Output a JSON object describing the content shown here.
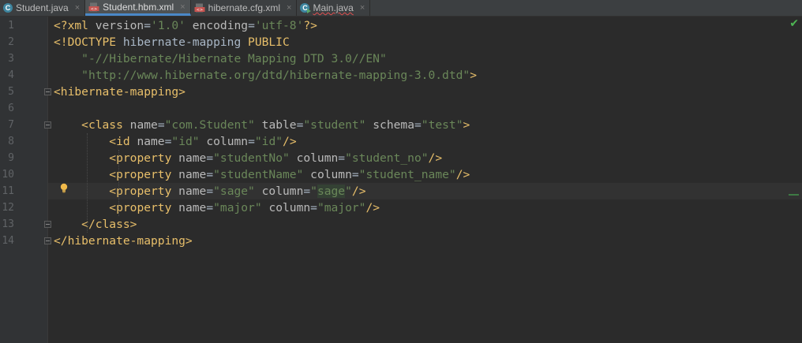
{
  "tabs": [
    {
      "label": "Student.java",
      "icon": "java-class-icon",
      "active": false
    },
    {
      "label": "Student.hbm.xml",
      "icon": "xml-file-icon",
      "active": true
    },
    {
      "label": "hibernate.cfg.xml",
      "icon": "xml-file-icon",
      "active": false
    },
    {
      "label": "Main.java",
      "icon": "java-main-class-icon",
      "active": false
    }
  ],
  "close_glyph": "×",
  "editor": {
    "current_line": 11,
    "lines": [
      {
        "n": "1",
        "tokens": [
          [
            "t-tag",
            "<?xml "
          ],
          [
            "t-attr",
            "version"
          ],
          [
            "t-plain",
            "="
          ],
          [
            "t-val",
            "'1.0'"
          ],
          [
            "t-plain",
            " "
          ],
          [
            "t-attr",
            "encoding"
          ],
          [
            "t-plain",
            "="
          ],
          [
            "t-val",
            "'utf-8'"
          ],
          [
            "t-tag",
            "?>"
          ]
        ]
      },
      {
        "n": "2",
        "tokens": [
          [
            "t-tag",
            "<!DOCTYPE "
          ],
          [
            "t-plain",
            "hibernate-mapping "
          ],
          [
            "t-tag",
            "PUBLIC"
          ]
        ]
      },
      {
        "n": "3",
        "tokens": [
          [
            "t-plain",
            "    "
          ],
          [
            "t-val",
            "\"-//Hibernate/Hibernate Mapping DTD 3.0//EN\""
          ]
        ]
      },
      {
        "n": "4",
        "tokens": [
          [
            "t-plain",
            "    "
          ],
          [
            "t-val",
            "\"http://www.hibernate.org/dtd/hibernate-mapping-3.0.dtd\""
          ],
          [
            "t-tag",
            ">"
          ]
        ]
      },
      {
        "n": "5",
        "tokens": [
          [
            "t-tag",
            "<hibernate-mapping>"
          ]
        ]
      },
      {
        "n": "6",
        "tokens": []
      },
      {
        "n": "7",
        "tokens": [
          [
            "t-plain",
            "    "
          ],
          [
            "t-tag",
            "<class "
          ],
          [
            "t-attr",
            "name"
          ],
          [
            "t-plain",
            "="
          ],
          [
            "t-val",
            "\"com.Student\""
          ],
          [
            "t-plain",
            " "
          ],
          [
            "t-attr",
            "table"
          ],
          [
            "t-plain",
            "="
          ],
          [
            "t-val",
            "\"student\""
          ],
          [
            "t-plain",
            " "
          ],
          [
            "t-attr",
            "schema"
          ],
          [
            "t-plain",
            "="
          ],
          [
            "t-val",
            "\"test\""
          ],
          [
            "t-tag",
            ">"
          ]
        ]
      },
      {
        "n": "8",
        "tokens": [
          [
            "t-plain",
            "        "
          ],
          [
            "t-tag",
            "<id "
          ],
          [
            "t-attr",
            "name"
          ],
          [
            "t-plain",
            "="
          ],
          [
            "t-val",
            "\"id\""
          ],
          [
            "t-plain",
            " "
          ],
          [
            "t-attr",
            "column"
          ],
          [
            "t-plain",
            "="
          ],
          [
            "t-val",
            "\"id\""
          ],
          [
            "t-tag",
            "/>"
          ]
        ]
      },
      {
        "n": "9",
        "tokens": [
          [
            "t-plain",
            "        "
          ],
          [
            "t-tag",
            "<property "
          ],
          [
            "t-attr",
            "name"
          ],
          [
            "t-plain",
            "="
          ],
          [
            "t-val",
            "\"studentNo\""
          ],
          [
            "t-plain",
            " "
          ],
          [
            "t-attr",
            "column"
          ],
          [
            "t-plain",
            "="
          ],
          [
            "t-val",
            "\"student_no\""
          ],
          [
            "t-tag",
            "/>"
          ]
        ]
      },
      {
        "n": "10",
        "tokens": [
          [
            "t-plain",
            "        "
          ],
          [
            "t-tag",
            "<property "
          ],
          [
            "t-attr",
            "name"
          ],
          [
            "t-plain",
            "="
          ],
          [
            "t-val",
            "\"studentName\""
          ],
          [
            "t-plain",
            " "
          ],
          [
            "t-attr",
            "column"
          ],
          [
            "t-plain",
            "="
          ],
          [
            "t-val",
            "\"student_name\""
          ],
          [
            "t-tag",
            "/>"
          ]
        ]
      },
      {
        "n": "11",
        "tokens": [
          [
            "t-plain",
            "        "
          ],
          [
            "t-tag",
            "<property "
          ],
          [
            "t-attr",
            "name"
          ],
          [
            "t-plain",
            "="
          ],
          [
            "t-val",
            "\"sage\""
          ],
          [
            "t-plain",
            " "
          ],
          [
            "t-attr",
            "column"
          ],
          [
            "t-plain",
            "="
          ],
          [
            "t-val",
            "\""
          ],
          [
            "t-val hl",
            "sage"
          ],
          [
            "t-val",
            "\""
          ],
          [
            "t-tag",
            "/>"
          ]
        ]
      },
      {
        "n": "12",
        "tokens": [
          [
            "t-plain",
            "        "
          ],
          [
            "t-tag",
            "<property "
          ],
          [
            "t-attr",
            "name"
          ],
          [
            "t-plain",
            "="
          ],
          [
            "t-val",
            "\"major\""
          ],
          [
            "t-plain",
            " "
          ],
          [
            "t-attr",
            "column"
          ],
          [
            "t-plain",
            "="
          ],
          [
            "t-val",
            "\"major\""
          ],
          [
            "t-tag",
            "/>"
          ]
        ]
      },
      {
        "n": "13",
        "tokens": [
          [
            "t-plain",
            "    "
          ],
          [
            "t-tag",
            "</class>"
          ]
        ]
      },
      {
        "n": "14",
        "tokens": [
          [
            "t-tag",
            "</hibernate-mapping>"
          ]
        ]
      }
    ]
  },
  "status": {
    "check_icon": "check-icon",
    "check_glyph": "✔",
    "intention_icon": "lightbulb-icon"
  },
  "colors": {
    "tag": "#e8bf6a",
    "attr": "#bababa",
    "value": "#6a8759",
    "background": "#2b2b2b",
    "accent": "#4a88c7"
  }
}
